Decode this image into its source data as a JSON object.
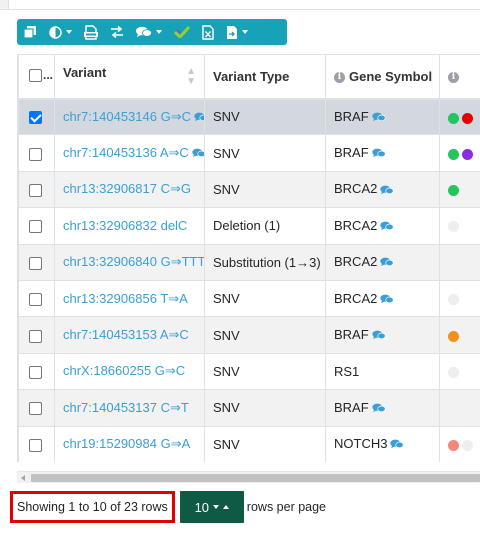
{
  "toolbar": {
    "buttons": [
      {
        "icon": "copy-icon"
      },
      {
        "icon": "contrast-icon",
        "dropdown": true
      },
      {
        "icon": "vcf-file-icon"
      },
      {
        "icon": "swap-icon"
      },
      {
        "icon": "comments-icon",
        "dropdown": true
      },
      {
        "icon": "check-icon"
      },
      {
        "icon": "excel-file-icon"
      },
      {
        "icon": "file-export-icon",
        "dropdown": true
      }
    ],
    "color": "#17a2b8"
  },
  "table": {
    "header": {
      "select_all_label": "...",
      "variant": "Variant",
      "variant_type": "Variant Type",
      "gene_symbol": "Gene Symbol"
    },
    "rows": [
      {
        "variant": "chr7:140453146 G⇒C",
        "variant_comment": true,
        "type": "SNV",
        "gene": "BRAF",
        "gene_comment": true,
        "checked": true,
        "dots": [
          "#22c55e",
          "#e60000"
        ]
      },
      {
        "variant": "chr7:140453136 A⇒C",
        "variant_comment": true,
        "type": "SNV",
        "gene": "BRAF",
        "gene_comment": true,
        "checked": false,
        "dots": [
          "#22c55e",
          "#8a2be2"
        ]
      },
      {
        "variant": "chr13:32906817 C⇒G",
        "variant_comment": false,
        "type": "SNV",
        "gene": "BRCA2",
        "gene_comment": true,
        "checked": false,
        "dots": [
          "#22c55e"
        ]
      },
      {
        "variant": "chr13:32906832 delC",
        "variant_comment": false,
        "type": "Deletion (1)",
        "gene": "BRCA2",
        "gene_comment": true,
        "checked": false,
        "dots": [
          "#eeeeee"
        ]
      },
      {
        "variant": "chr13:32906840 G⇒TTT",
        "variant_comment": false,
        "type": "Substitution (1→3)",
        "gene": "BRCA2",
        "gene_comment": true,
        "checked": false,
        "dots": []
      },
      {
        "variant": "chr13:32906856 T⇒A",
        "variant_comment": false,
        "type": "SNV",
        "gene": "BRCA2",
        "gene_comment": true,
        "checked": false,
        "dots": [
          "#eeeeee"
        ]
      },
      {
        "variant": "chr7:140453153 A⇒C",
        "variant_comment": false,
        "type": "SNV",
        "gene": "BRAF",
        "gene_comment": true,
        "checked": false,
        "dots": [
          "#f39019"
        ]
      },
      {
        "variant": "chrX:18660255 G⇒C",
        "variant_comment": false,
        "type": "SNV",
        "gene": "RS1",
        "gene_comment": false,
        "checked": false,
        "dots": [
          "#eeeeee"
        ]
      },
      {
        "variant": "chr7:140453137 C⇒T",
        "variant_comment": false,
        "type": "SNV",
        "gene": "BRAF",
        "gene_comment": true,
        "checked": false,
        "dots": []
      },
      {
        "variant": "chr19:15290984 G⇒A",
        "variant_comment": false,
        "type": "SNV",
        "gene": "NOTCH3",
        "gene_comment": true,
        "checked": false,
        "dots": [
          "#f4877a",
          "#eeeeee"
        ]
      }
    ]
  },
  "pagination": {
    "showing_text": "Showing 1 to 10 of 23 rows",
    "page_size": "10",
    "rows_per_page_label": "rows per page",
    "page_size_color": "#0f5a45",
    "highlight_color": "#e00000"
  }
}
